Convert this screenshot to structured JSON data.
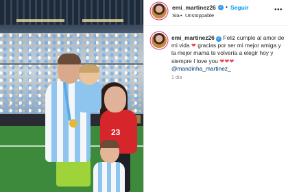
{
  "post": {
    "username": "emi_martinez26",
    "verified_mark": "✓",
    "follow_label": "Seguir",
    "location": "Sia",
    "audio": "Unstoppable",
    "separator": "•",
    "more_icon": "more-horizontal-icon"
  },
  "photo": {
    "jersey_number": "23",
    "description_icons": [
      "stadium",
      "players",
      "family"
    ]
  },
  "caption": {
    "username": "emi_martinez26",
    "part1": "Feliz cumple al amor de mi vida",
    "heart": "❤",
    "part2": "gracias por ser mi mejor amiga y la mejor mamá te volvería a elegir hoy y siempre I love you",
    "hearts": "❤❤❤",
    "mention": "@mandinha_martinez_",
    "time": "1 día"
  },
  "colors": {
    "follow_blue": "#0095f6",
    "verified_blue": "#3897f0",
    "heart_red": "#ed4956",
    "mention_blue": "#00376b"
  }
}
